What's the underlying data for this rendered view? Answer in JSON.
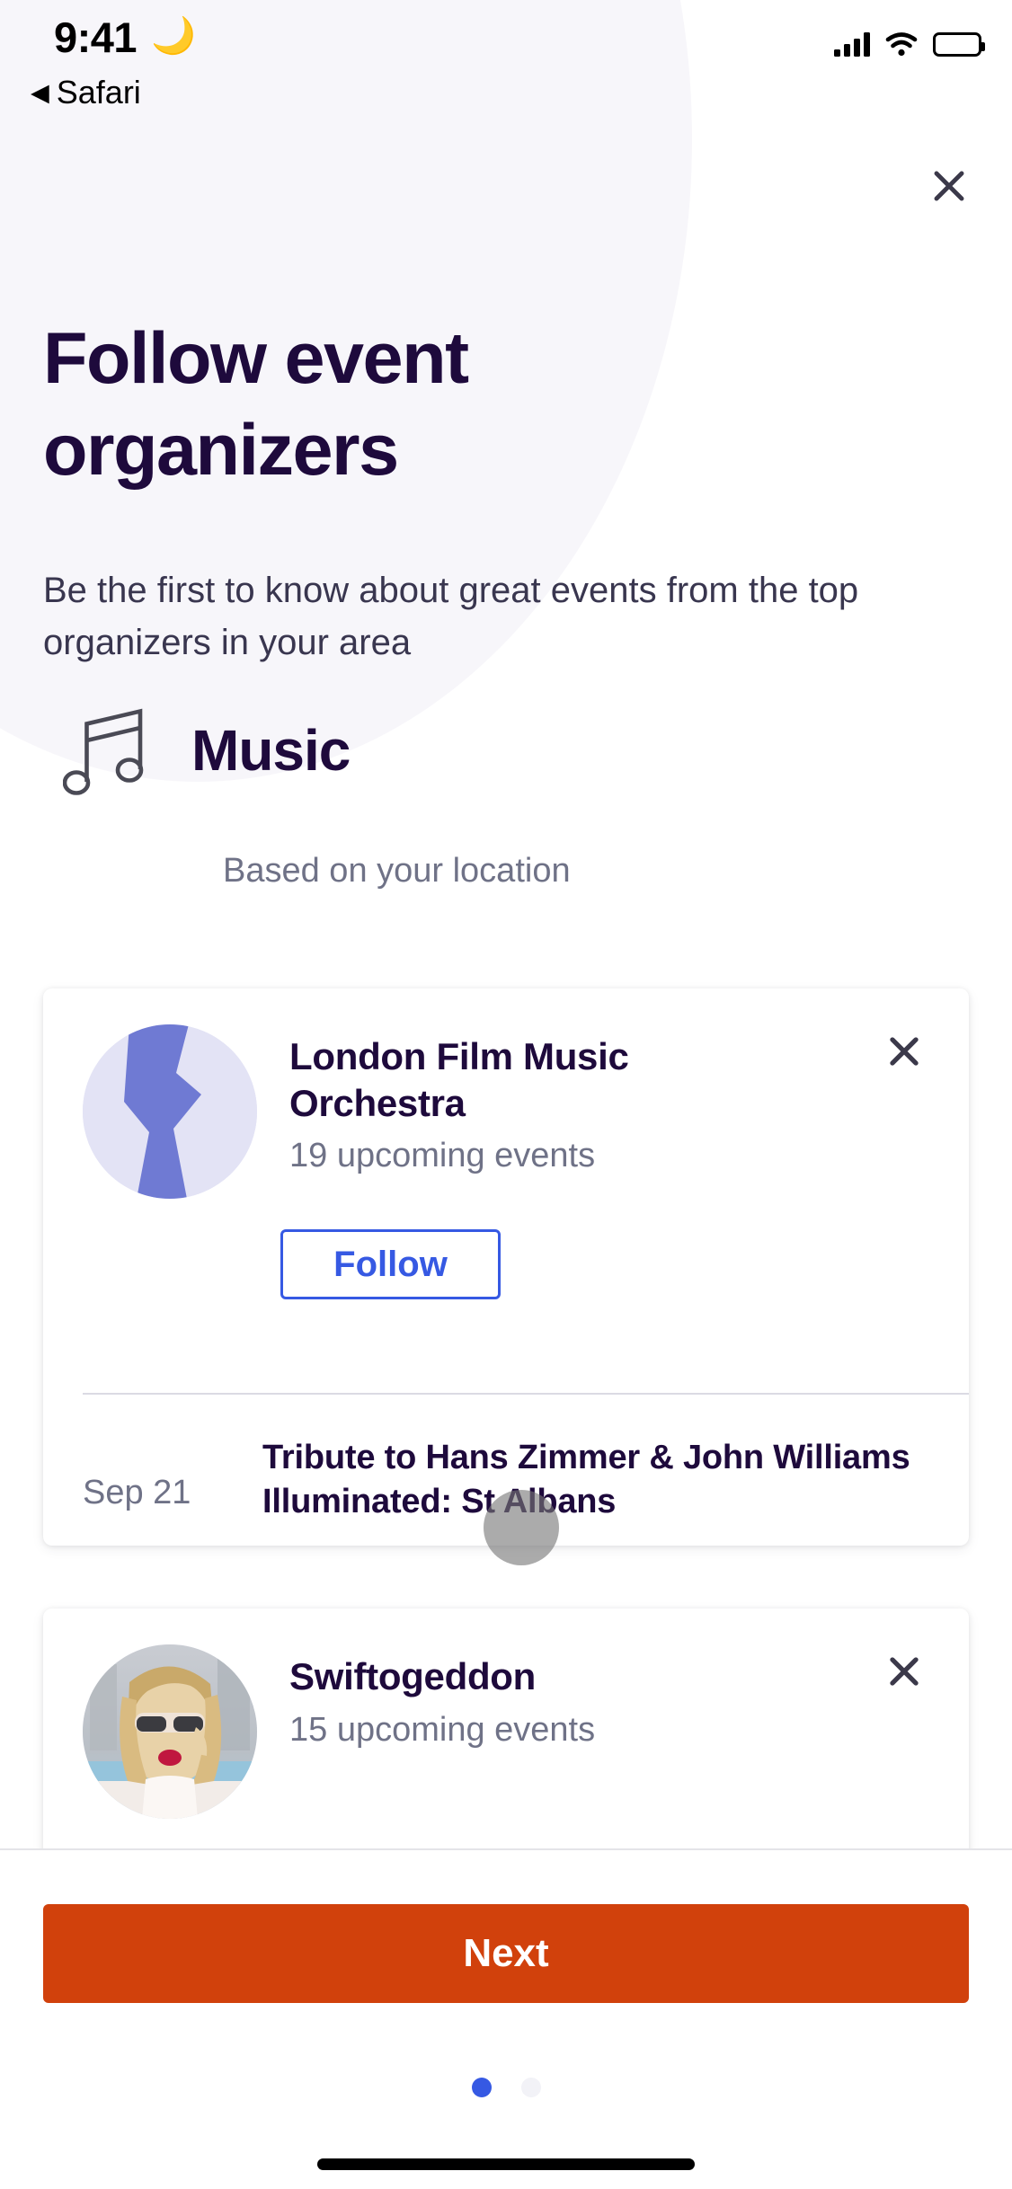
{
  "status_bar": {
    "time": "9:41",
    "moon_icon": "crescent-moon-icon",
    "back_label": "Safari",
    "back_arrow": "◀",
    "signal_icon": "cellular-signal-icon",
    "wifi_icon": "wifi-icon",
    "battery_icon": "battery-full-icon"
  },
  "header": {
    "close_icon": "close-icon",
    "headline": "Follow event organizers",
    "subtitle": "Be the first to know about great events from the top organizers in your area"
  },
  "category": {
    "icon": "music-note-icon",
    "title": "Music",
    "subtitle": "Based on your location"
  },
  "organizers": [
    {
      "avatar": "abstract-logo-avatar",
      "name": "London Film Music Orchestra",
      "events_count": "19 upcoming events",
      "follow_label": "Follow",
      "remove_icon": "close-icon",
      "event": {
        "date": "Sep 21",
        "title": "Tribute to Hans Zimmer & John Williams Illuminated: St Albans"
      }
    },
    {
      "avatar": "photo-avatar",
      "name": "Swiftogeddon",
      "events_count": "15 upcoming events",
      "remove_icon": "close-icon"
    }
  ],
  "footer": {
    "next_label": "Next",
    "pagination": {
      "total": 2,
      "active_index": 0
    }
  },
  "colors": {
    "headline": "#1e0a3c",
    "body_text": "#39364f",
    "muted_text": "#6f7287",
    "accent_blue": "#3659e3",
    "primary_orange": "#d1410c",
    "blob_bg": "#f7f6fa",
    "avatar_bg": "#e3e3f5",
    "avatar_shape": "#6f7ad3"
  }
}
